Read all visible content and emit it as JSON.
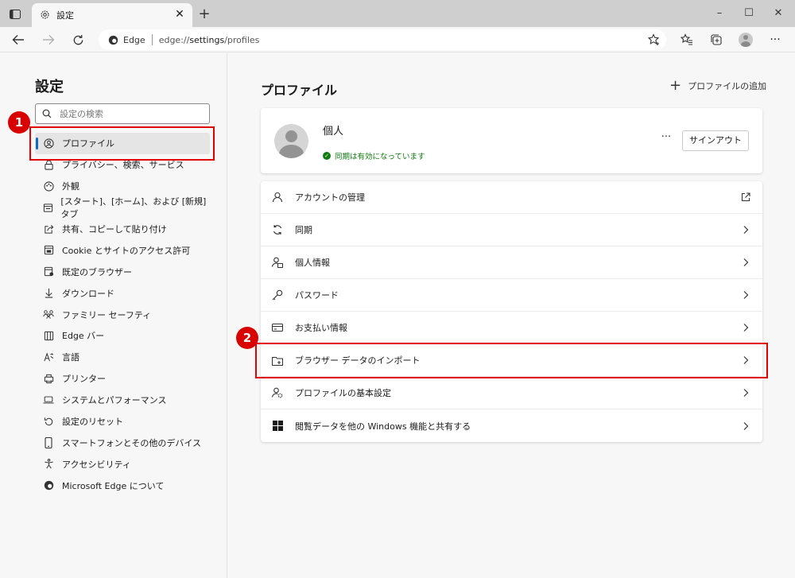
{
  "browser": {
    "tab_title": "設定",
    "address_site": "Edge",
    "address_url_prefix": "edge://",
    "address_url_bold": "settings",
    "address_url_suffix": "/profiles"
  },
  "sidebar": {
    "title": "設定",
    "search_placeholder": "設定の検索",
    "items": [
      {
        "label": "プロファイル",
        "icon": "profile-icon",
        "active": true
      },
      {
        "label": "プライバシー、検索、サービス",
        "icon": "lock-icon"
      },
      {
        "label": "外観",
        "icon": "appearance-icon"
      },
      {
        "label": "[スタート]、[ホーム]、および [新規] タブ",
        "icon": "home-tab-icon"
      },
      {
        "label": "共有、コピーして貼り付け",
        "icon": "share-icon"
      },
      {
        "label": "Cookie とサイトのアクセス許可",
        "icon": "cookie-icon"
      },
      {
        "label": "既定のブラウザー",
        "icon": "browser-icon"
      },
      {
        "label": "ダウンロード",
        "icon": "download-icon"
      },
      {
        "label": "ファミリー セーフティ",
        "icon": "family-icon"
      },
      {
        "label": "Edge バー",
        "icon": "edge-bar-icon"
      },
      {
        "label": "言語",
        "icon": "language-icon"
      },
      {
        "label": "プリンター",
        "icon": "printer-icon"
      },
      {
        "label": "システムとパフォーマンス",
        "icon": "laptop-icon"
      },
      {
        "label": "設定のリセット",
        "icon": "reset-icon"
      },
      {
        "label": "スマートフォンとその他のデバイス",
        "icon": "phone-icon"
      },
      {
        "label": "アクセシビリティ",
        "icon": "accessibility-icon"
      },
      {
        "label": "Microsoft Edge について",
        "icon": "edge-logo-icon"
      }
    ]
  },
  "main": {
    "title": "プロファイル",
    "add_profile": "プロファイルの追加",
    "profile": {
      "name": "個人",
      "sync_status": "同期は有効になっています",
      "more": "···",
      "signout": "サインアウト"
    },
    "rows": [
      {
        "label": "アカウントの管理",
        "icon": "account-icon",
        "trail": "external-link-icon"
      },
      {
        "label": "同期",
        "icon": "sync-icon",
        "trail": "chevron-right-icon"
      },
      {
        "label": "個人情報",
        "icon": "personal-info-icon",
        "trail": "chevron-right-icon"
      },
      {
        "label": "パスワード",
        "icon": "key-icon",
        "trail": "chevron-right-icon"
      },
      {
        "label": "お支払い情報",
        "icon": "card-icon",
        "trail": "chevron-right-icon"
      },
      {
        "label": "ブラウザー データのインポート",
        "icon": "import-icon",
        "trail": "chevron-right-icon"
      },
      {
        "label": "プロファイルの基本設定",
        "icon": "profile-prefs-icon",
        "trail": "chevron-right-icon"
      },
      {
        "label": "閲覧データを他の Windows 機能と共有する",
        "icon": "windows-icon",
        "trail": "chevron-right-icon"
      }
    ]
  },
  "annotations": {
    "badge1": "1",
    "badge2": "2",
    "color": "#e00000"
  }
}
